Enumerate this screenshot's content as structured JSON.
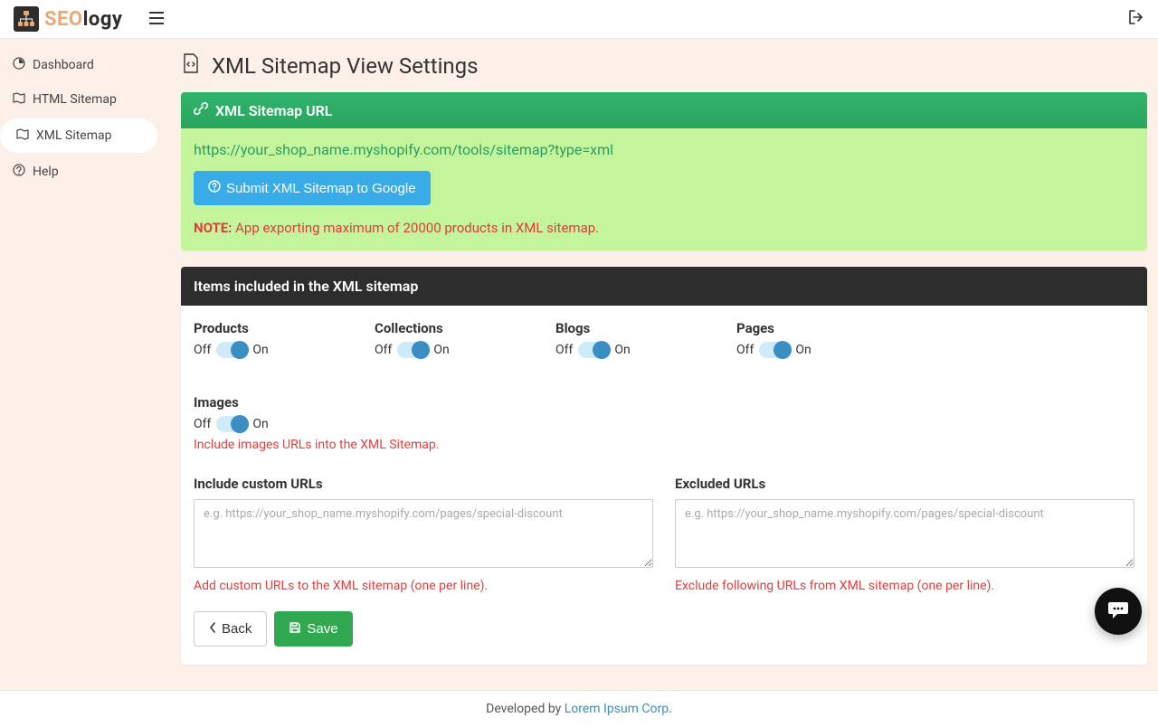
{
  "app": {
    "brand_seo": "SEO",
    "brand_logy": "logy"
  },
  "sidebar": {
    "items": [
      {
        "label": "Dashboard"
      },
      {
        "label": "HTML Sitemap"
      },
      {
        "label": "XML Sitemap"
      },
      {
        "label": "Help"
      }
    ]
  },
  "page": {
    "title": "XML Sitemap View Settings"
  },
  "url_panel": {
    "heading": "XML Sitemap URL",
    "url": "https://your_shop_name.myshopify.com/tools/sitemap?type=xml",
    "submit_label": "Submit XML Sitemap to Google",
    "note_strong": "NOTE:",
    "note_rest": " App exporting maximum of 20000 products in XML sitemap."
  },
  "items_panel": {
    "heading": "Items included in the XML sitemap",
    "off": "Off",
    "on": "On",
    "toggles": [
      {
        "label": "Products"
      },
      {
        "label": "Collections"
      },
      {
        "label": "Blogs"
      },
      {
        "label": "Pages"
      },
      {
        "label": "Images",
        "help": "Include images URLs into the XML Sitemap."
      }
    ],
    "include": {
      "label": "Include custom URLs",
      "placeholder": "e.g. https://your_shop_name.myshopify.com/pages/special-discount",
      "help": "Add custom URLs to the XML sitemap (one per line)."
    },
    "exclude": {
      "label": "Excluded URLs",
      "placeholder": "e.g. https://your_shop_name.myshopify.com/pages/special-discount",
      "help": "Exclude following URLs from XML sitemap (one per line)."
    },
    "back": "Back",
    "save": "Save"
  },
  "footer": {
    "prefix": "Developed by ",
    "link": "Lorem Ipsum Corp",
    "suffix": "."
  }
}
